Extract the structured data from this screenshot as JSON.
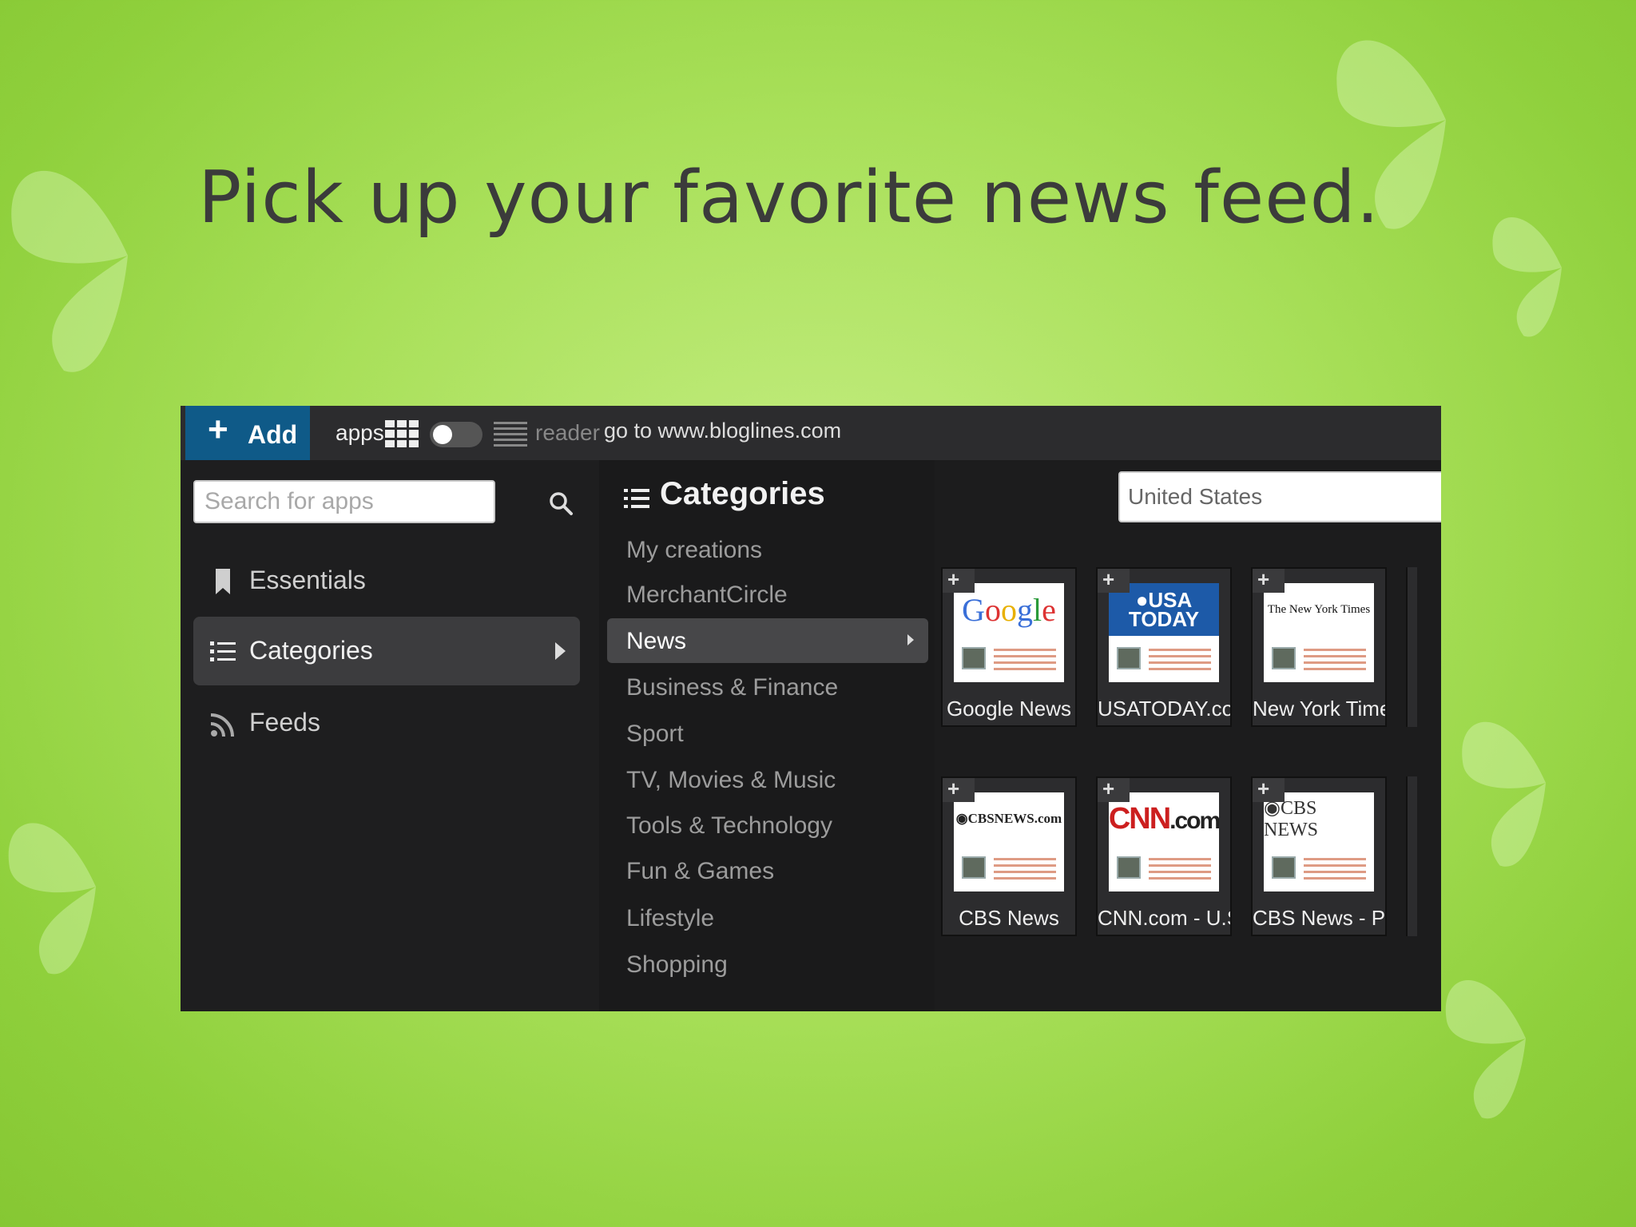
{
  "slide": {
    "title": "Pick up your favorite news feed."
  },
  "toolbar": {
    "add_label": "Add",
    "apps_label": "apps",
    "reader_label": "reader",
    "goto_text": "go to www.bloglines.com"
  },
  "search": {
    "placeholder": "Search for apps"
  },
  "sidebar": {
    "items": [
      {
        "label": "Essentials",
        "icon": "bookmark-icon"
      },
      {
        "label": "Categories",
        "icon": "list-icon",
        "active": true
      },
      {
        "label": "Feeds",
        "icon": "rss-icon"
      }
    ]
  },
  "categories": {
    "header": "Categories",
    "items": [
      "My creations",
      "MerchantCircle",
      "News",
      "Business & Finance",
      "Sport",
      "TV, Movies & Music",
      "Tools & Technology",
      "Fun & Games",
      "Lifestyle",
      "Shopping"
    ],
    "active": "News"
  },
  "country": {
    "value": "United States"
  },
  "tiles": [
    {
      "label": "Google News",
      "logo": "Google"
    },
    {
      "label": "USATODAY.coı",
      "logo": "USA TODAY"
    },
    {
      "label": "New York Time",
      "logo": "The New York Times"
    },
    {
      "label": "CBS News",
      "logo": "CBSNEWS.com"
    },
    {
      "label": "CNN.com - U.S",
      "logo": "CNN.com"
    },
    {
      "label": "CBS News - Pre",
      "logo": "CBS NEWS"
    }
  ],
  "colors": {
    "add_button": "#0f5a88",
    "background_green": "#a9e05a",
    "panel_dark": "#1e1e1f"
  }
}
